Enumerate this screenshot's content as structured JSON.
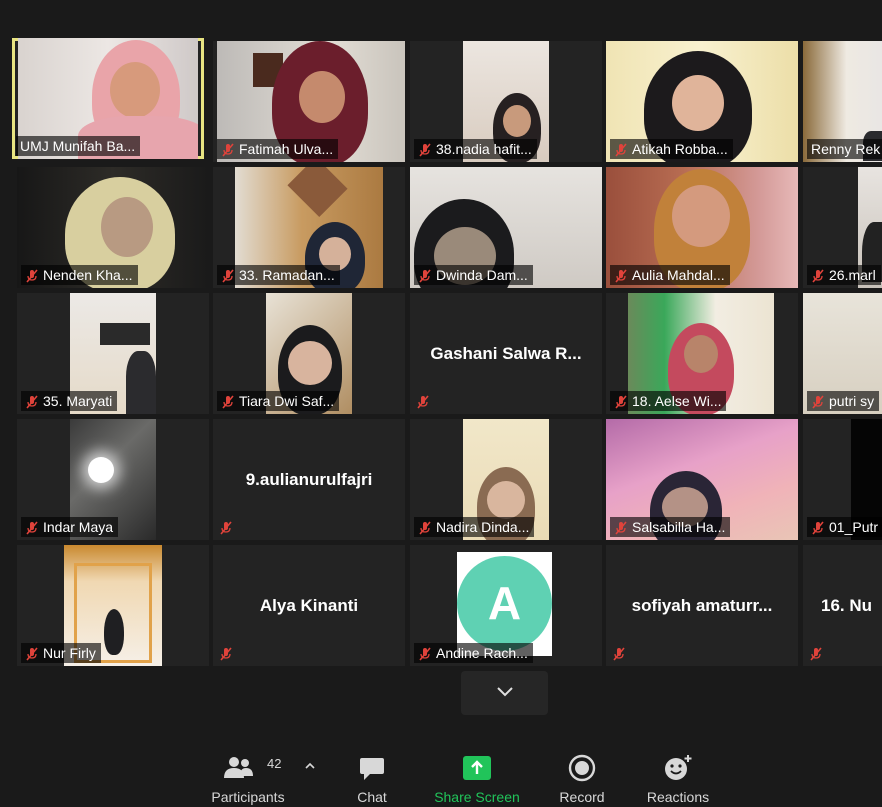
{
  "participants": [
    {
      "name": "UMJ Munifah Ba...",
      "active": true,
      "muted": false
    },
    {
      "name": "Fatimah Ulva...",
      "muted": true
    },
    {
      "name": "38.nadia hafit...",
      "muted": true
    },
    {
      "name": "Atikah Robba...",
      "muted": true
    },
    {
      "name": "Renny Rek",
      "muted": false
    },
    {
      "name": "Nenden Kha...",
      "muted": true
    },
    {
      "name": "33. Ramadan...",
      "muted": true
    },
    {
      "name": "Dwinda Dam...",
      "muted": true
    },
    {
      "name": "Aulia Mahdal...",
      "muted": true
    },
    {
      "name": "26.marl",
      "muted": true
    },
    {
      "name": "35. Maryati",
      "muted": true
    },
    {
      "name": "Tiara Dwi Saf...",
      "muted": true
    },
    {
      "name": "Gashani Salwa R...",
      "muted": true,
      "video_off": true
    },
    {
      "name": "18. Aelse Wi...",
      "muted": true
    },
    {
      "name": "putri sy",
      "muted": true
    },
    {
      "name": "Indar Maya",
      "muted": true
    },
    {
      "name": "9.aulianurulfajri",
      "muted": true,
      "video_off": true
    },
    {
      "name": "Nadira Dinda...",
      "muted": true
    },
    {
      "name": "Salsabilla Ha...",
      "muted": true
    },
    {
      "name": "01_Putr",
      "muted": true
    },
    {
      "name": "Nur Firly",
      "muted": true
    },
    {
      "name": "Alya Kinanti",
      "muted": true,
      "video_off": true
    },
    {
      "name": "Andine Rach...",
      "muted": true,
      "avatar_letter": "A"
    },
    {
      "name": "sofiyah amaturr...",
      "muted": true,
      "video_off": true
    },
    {
      "name": "16. Nu",
      "muted": true,
      "video_off": true
    }
  ],
  "colors": {
    "mute": "#e0433b",
    "share": "#21c45a",
    "avatar": "#5fd1b3",
    "active_border": "#e8e482"
  },
  "toolbar": {
    "participants_label": "Participants",
    "participants_count": "42",
    "chat_label": "Chat",
    "share_label": "Share Screen",
    "record_label": "Record",
    "reactions_label": "Reactions"
  }
}
